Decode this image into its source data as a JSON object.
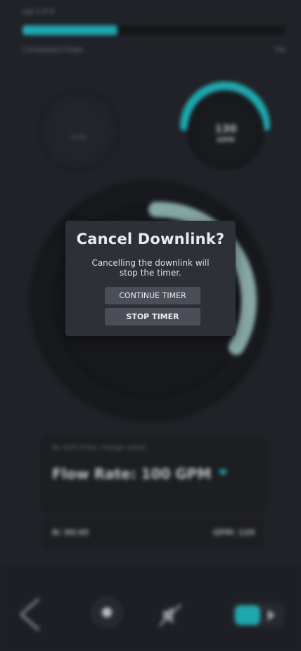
{
  "header": {
    "progress_caption": "Lap 2 of 4",
    "progress_fraction": 0.36,
    "progress_subcaption": "Completed Flows",
    "progress_percent": "3%"
  },
  "small_dial": {
    "label": "0:00"
  },
  "gpm_dial": {
    "value": "130",
    "unit": "GPM"
  },
  "flow_card": {
    "hint": "By start times, change values",
    "flow_rate": "Flow Rate: 100 GPM"
  },
  "stats": {
    "left": "N: 00:45",
    "right": "GPM: 120"
  },
  "colors": {
    "accent": "#22c9d2",
    "background": "#24272e",
    "modal_bg": "#2d3037",
    "button_bg": "#4a4e57"
  },
  "icons": {
    "back": "chevron-left-icon",
    "record": "record-icon",
    "mute": "mute-icon",
    "toggle": "toggle-icon"
  },
  "modal": {
    "title": "Cancel Downlink?",
    "message": "Cancelling the downlink will stop the timer.",
    "continue_label": "CONTINUE TIMER",
    "stop_label": "STOP TIMER"
  }
}
